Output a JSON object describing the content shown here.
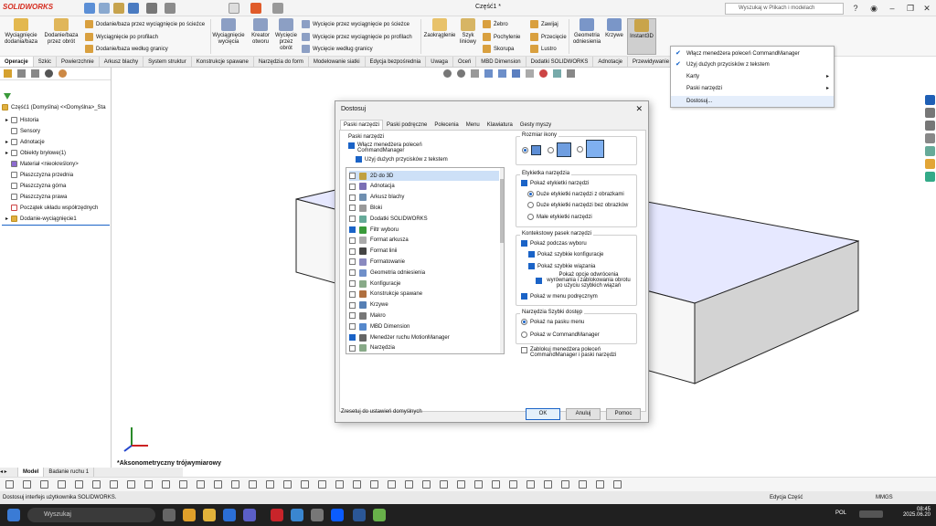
{
  "app": {
    "logo": "SOLIDWORKS",
    "doc_title": "Część1 *",
    "search_placeholder": "Wyszukaj w Plikach i modelach"
  },
  "colors": {
    "accent": "#1a63c7",
    "brand": "#d52b1e",
    "model_face": "#e8eaff",
    "model_side": "#d8d8d8"
  },
  "command_manager": {
    "big": [
      {
        "label": "Wyciągnięcie dodania/baza",
        "icon": "extrude-boss-icon"
      },
      {
        "label": "Dodanie/baza przez obrót",
        "icon": "revolve-boss-icon"
      },
      {
        "label": "Wyciągnięcie wycięcia",
        "icon": "extrude-cut-icon"
      },
      {
        "label": "Kreator otworu",
        "icon": "hole-wizard-icon"
      },
      {
        "label": "Wycięcie przez obrót",
        "icon": "revolve-cut-icon"
      },
      {
        "label": "Zaokrąglenie",
        "icon": "fillet-icon"
      },
      {
        "label": "Szyk liniowy",
        "icon": "linear-pattern-icon"
      },
      {
        "label": "Geometria odniesienia",
        "icon": "reference-geometry-icon"
      },
      {
        "label": "Krzywe",
        "icon": "curves-icon"
      },
      {
        "label": "Instant3D",
        "icon": "instant3d-icon"
      }
    ],
    "small": [
      "Dodanie/baza przez wyciągnięcie po ścieżce",
      "Wyciągnięcie po profilach",
      "Dodanie/baza według granicy",
      "Wycięcie przez wyciągnięcie po ścieżce",
      "Wycięcie przez wyciągnięcie po profilach",
      "Wycięcie według granicy",
      "Żebro",
      "Pochylenie",
      "Skorupa",
      "Zawijaj",
      "Przecięcie",
      "Lustro"
    ]
  },
  "tabs": [
    "Operacje",
    "Szkic",
    "Powierzchnie",
    "Arkusz blachy",
    "System struktur",
    "Konstrukcje spawane",
    "Narzędzia do form",
    "Modelowanie siatki",
    "Edycja bezpośrednia",
    "Uwaga",
    "Oceń",
    "MBD Dimension",
    "Dodatki SOLIDWORKS",
    "Adnotacje",
    "Przewidywanie"
  ],
  "context_menu": [
    {
      "label": "Włącz menedżera poleceń CommandManager",
      "checked": true
    },
    {
      "label": "Użyj dużych przycisków z tekstem",
      "checked": true
    },
    {
      "label": "Karty",
      "submenu": true
    },
    {
      "label": "Paski narzędzi",
      "submenu": true
    },
    {
      "label": "Dostosuj..."
    }
  ],
  "tree": {
    "root": "Część1 (Domyślna) <<Domyślna>_Sta",
    "items": [
      "Historia",
      "Sensory",
      "Adnotacje",
      "Obiekty bryłowe(1)",
      "Materiał <nieokreślony>",
      "Płaszczyzna przednia",
      "Płaszczyzna górna",
      "Płaszczyzna prawa",
      "Początek układu współrzędnych",
      "Dodanie-wyciągnięcie1"
    ]
  },
  "dialog": {
    "title": "Dostosuj",
    "tabs": [
      "Paski narzędzi",
      "Paski podręczne",
      "Polecenia",
      "Menu",
      "Klawiatura",
      "Gesty myszy"
    ],
    "toolbars_group": "Paski narzędzi",
    "enable_cm": "Włącz menedżera poleceń CommandManager",
    "large_buttons": "Użyj dużych przycisków z tekstem",
    "list": [
      {
        "label": "2D do 3D",
        "checked": false
      },
      {
        "label": "Adnotacja",
        "checked": false
      },
      {
        "label": "Arkusz blachy",
        "checked": false
      },
      {
        "label": "Bloki",
        "checked": false
      },
      {
        "label": "Dodatki SOLIDWORKS",
        "checked": false
      },
      {
        "label": "Filtr wyboru",
        "checked": true
      },
      {
        "label": "Format arkusza",
        "checked": false
      },
      {
        "label": "Format linii",
        "checked": false
      },
      {
        "label": "Formatowanie",
        "checked": false
      },
      {
        "label": "Geometria odniesienia",
        "checked": false
      },
      {
        "label": "Konfiguracje",
        "checked": false
      },
      {
        "label": "Konstrukcje spawane",
        "checked": false
      },
      {
        "label": "Krzywe",
        "checked": false
      },
      {
        "label": "Makro",
        "checked": false
      },
      {
        "label": "MBD Dimension",
        "checked": false
      },
      {
        "label": "Menedżer ruchu MotionManager",
        "checked": true
      },
      {
        "label": "Narzędzia",
        "checked": false
      }
    ],
    "icon_size": "Rozmiar ikony",
    "tool_label": "Etykietka narzędzia",
    "show_tooltips": "Pokaż etykietki narzędzi",
    "large_tips_img": "Duże etykietki narzędzi z obrazkami",
    "large_tips_noimg": "Duże etykietki narzędzi bez obrazków",
    "small_tips": "Małe etykietki narzędzi",
    "ctx_toolbar": "Kontekstowy pasek narzędzi",
    "show_on_select": "Pokaż podczas wyboru",
    "quick_config": "Pokaż szybkie konfiguracje",
    "quick_mates": "Pokaż szybkie wiązania",
    "align_opt": "Pokaż opcje odwrócenia wyrównania i zablokowania obrotu po użyciu szybkich wiązań",
    "show_in_menu": "Pokaż w menu podręcznym",
    "shortcut": "Narzędzia Szybki dostęp",
    "show_in_toolbar": "Pokaż na pasku menu",
    "show_in_cm": "Pokaż w CommandManager",
    "lock_cm": "Zablokuj menedżera poleceń CommandManager i paski narzędzi",
    "reset": "Zresetuj do ustawień domyślnych",
    "ok": "OK",
    "cancel": "Anuluj",
    "help": "Pomoc"
  },
  "viewport_label": "*Aksonometryczny trójwymiarowy",
  "model_tabs": [
    "Model",
    "Badanie ruchu 1"
  ],
  "status": {
    "left": "Dostosuj interfejs użytkownika SOLIDWORKS.",
    "mid": "Edycja Część",
    "units": "MMGS"
  },
  "taskbar": {
    "search": "Wyszukaj",
    "lang": "POL",
    "time": "08:45",
    "date": "2025.06.20"
  }
}
